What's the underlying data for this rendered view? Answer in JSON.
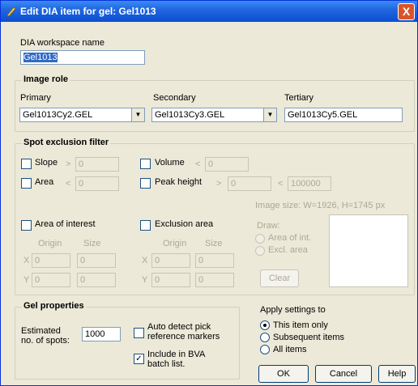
{
  "window": {
    "title": "Edit DIA item for gel: Gel1013",
    "close_symbol": "X"
  },
  "workspace": {
    "label": "DIA workspace name",
    "value": "Gel1013"
  },
  "image_role": {
    "title": "Image role",
    "primary_label": "Primary",
    "primary_value": "Gel1013Cy2.GEL",
    "secondary_label": "Secondary",
    "secondary_value": "Gel1013Cy3.GEL",
    "tertiary_label": "Tertiary",
    "tertiary_value": "Gel1013Cy5.GEL",
    "arrow": "▼"
  },
  "filter": {
    "title": "Spot exclusion filter",
    "slope_label": "Slope",
    "slope_op": ">",
    "slope_value": "0",
    "area_label": "Area",
    "area_op": "<",
    "area_value": "0",
    "volume_label": "Volume",
    "volume_op": "<",
    "volume_value": "0",
    "peak_label": "Peak height",
    "peak_op": ">",
    "peak_value": "0",
    "peak_op2": "<",
    "peak_value2": "100000",
    "image_size": "Image size: W=1926, H=1745 px",
    "aoi_label": "Area of interest",
    "excl_label": "Exclusion area",
    "origin": "Origin",
    "size": "Size",
    "x": "X",
    "y": "Y",
    "zero": "0",
    "draw_label": "Draw:",
    "draw_aoi": "Area of int.",
    "draw_excl": "Excl. area",
    "clear": "Clear"
  },
  "gel": {
    "title": "Gel properties",
    "est_label_1": "Estimated",
    "est_label_2": "no. of spots:",
    "est_value": "1000",
    "auto_1": "Auto detect pick",
    "auto_2": "reference markers",
    "bva_1": "Include in BVA",
    "bva_2": "batch list.",
    "check_mark": "✓"
  },
  "apply": {
    "title": "Apply settings to",
    "opt1": "This item only",
    "opt2": "Subsequent items",
    "opt3": "All items"
  },
  "buttons": {
    "ok": "OK",
    "cancel": "Cancel",
    "help": "Help"
  }
}
